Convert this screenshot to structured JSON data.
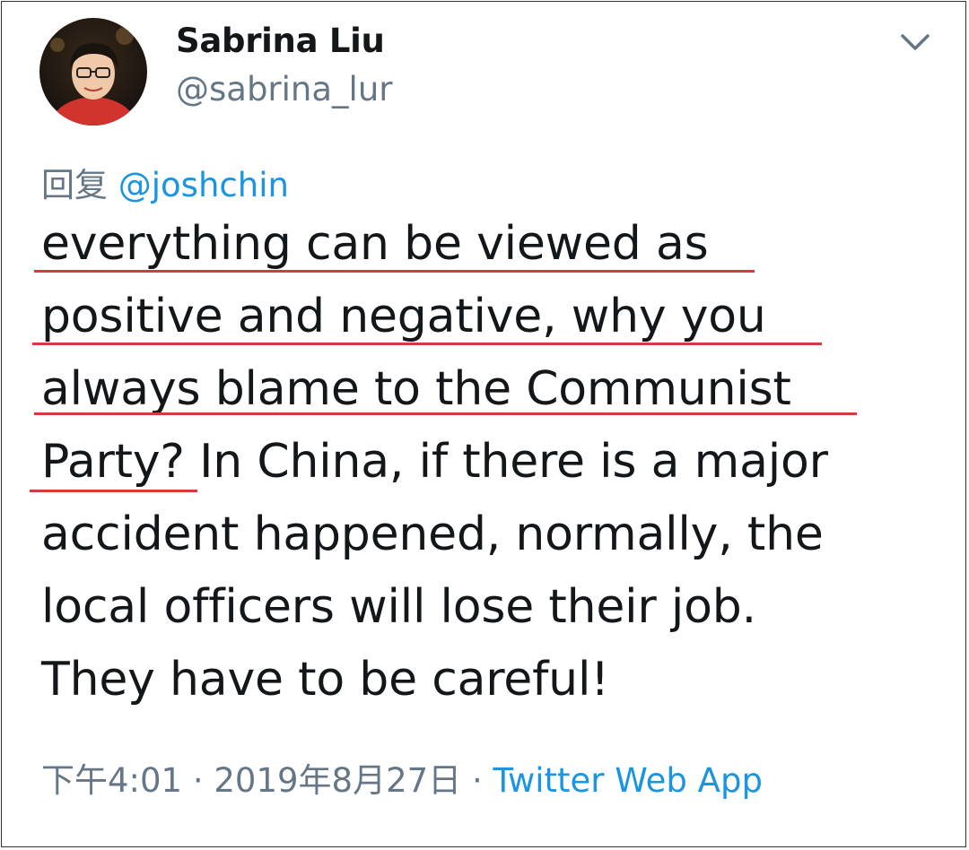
{
  "tweet": {
    "display_name": "Sabrina Liu",
    "handle": "@sabrina_lur",
    "reply_prefix": "回复",
    "reply_to": "@joshchin",
    "lines": [
      "everything can be viewed as",
      "positive and negative, why you",
      "always blame to the Communist",
      "Party? In China, if there is a major",
      "accident happened, normally, the",
      "local officers will lose their job.",
      "They have to be careful!"
    ],
    "time": "下午4:01",
    "date": "2019年8月27日",
    "separator": "·",
    "source": "Twitter Web App"
  },
  "icons": {
    "menu": "chevron-down-icon",
    "avatar": "profile-photo"
  },
  "colors": {
    "text": "#14171a",
    "secondary": "#657786",
    "link": "#1b95e0",
    "annotation_underline": "#d63a3a"
  }
}
